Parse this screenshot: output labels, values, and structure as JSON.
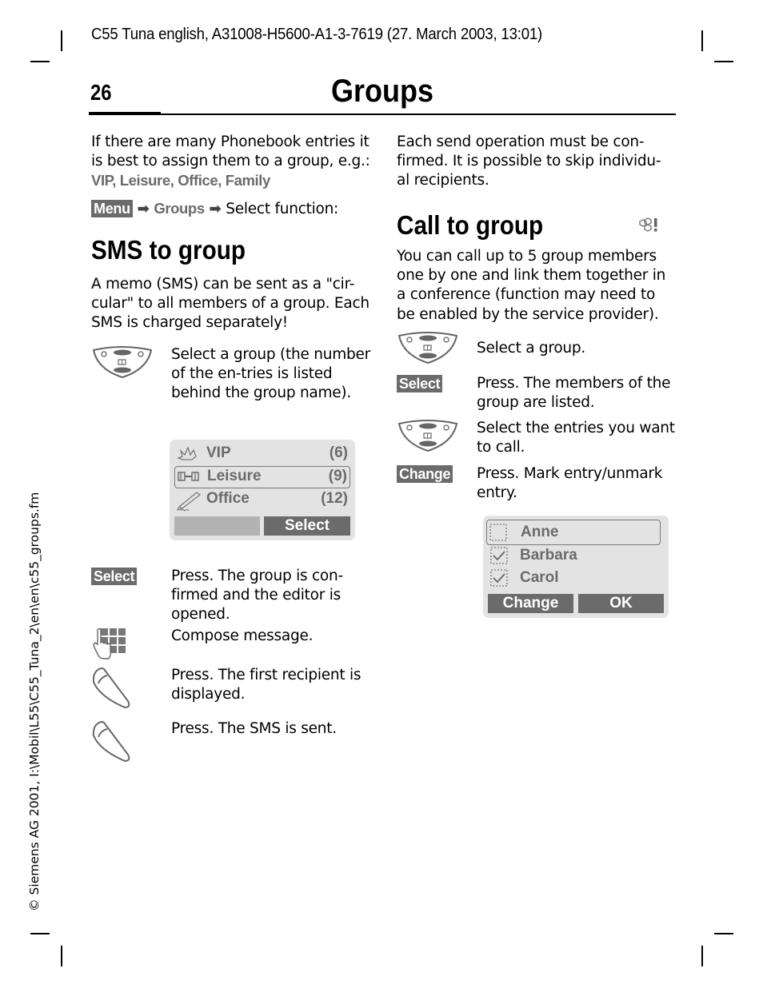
{
  "document": {
    "header_line": "C55 Tuna english, A31008-H5600-A1-3-7619 (27. March 2003, 13:01)",
    "page_number": "26",
    "page_title": "Groups",
    "side_text": "© Siemens AG 2001, I:\\Mobil\\L55\\C55_Tuna_2\\en\\en\\c55_groups.fm"
  },
  "intro": {
    "text": "If there are many Phonebook entries it is best to assign them to a group, e.g.: ",
    "examples": "VIP, Leisure, Office, Family",
    "menu_key": "Menu",
    "arrow": "➡",
    "groups_item": "Groups",
    "select_function": "Select function:"
  },
  "sms_section": {
    "title": "SMS to group",
    "description": "A memo (SMS) can be sent as a \"cir-cular\" to all members of a group. Each SMS is charged separately!",
    "steps": [
      {
        "icon": "navigation-key-icon",
        "text": "Select a group (the number of the en-tries is listed behind the group name)."
      },
      {
        "icon": "softkey",
        "key": "Select",
        "text": "Press. The group is con-firmed and the editor is opened."
      },
      {
        "icon": "keypad-icon",
        "text": "Compose message."
      },
      {
        "icon": "call-key-icon",
        "text": "Press. The first recipient is displayed."
      },
      {
        "icon": "call-key-icon",
        "text": "Press. The SMS is sent."
      }
    ],
    "screen": {
      "rows": [
        {
          "icon": "crown-icon",
          "label": "VIP",
          "count": "(6)",
          "selected": false
        },
        {
          "icon": "dumbbell-icon",
          "label": "Leisure",
          "count": "(9)",
          "selected": true
        },
        {
          "icon": "pen-icon",
          "label": "Office",
          "count": "(12)",
          "selected": false
        }
      ],
      "softkey_left": "",
      "softkey_right": "Select"
    }
  },
  "right_intro": {
    "text": "Each send operation must be con-firmed. It is possible to skip individu-al recipients."
  },
  "call_section": {
    "title": "Call to group",
    "badge": "network-service-icon",
    "description": "You can call up to 5 group members one by one and link them together in a conference (function may need to be enabled by the service provider).",
    "steps": [
      {
        "icon": "navigation-key-icon",
        "text": "Select a group."
      },
      {
        "icon": "softkey",
        "key": "Select",
        "text": "Press. The members of the group are listed."
      },
      {
        "icon": "navigation-key-icon",
        "text": "Select the entries you want to call."
      },
      {
        "icon": "softkey",
        "key": "Change",
        "text": "Press. Mark entry/unmark entry."
      }
    ],
    "screen": {
      "rows": [
        {
          "label": "Anne",
          "checked": false,
          "selected": true
        },
        {
          "label": "Barbara",
          "checked": true,
          "selected": false
        },
        {
          "label": "Carol",
          "checked": true,
          "selected": false
        }
      ],
      "softkey_left": "Change",
      "softkey_right": "OK"
    }
  },
  "colors": {
    "softkey_bg": "#6b6b6b",
    "screen_bg": "#e3e3e3",
    "highlight_text": "#6b6b6b"
  }
}
